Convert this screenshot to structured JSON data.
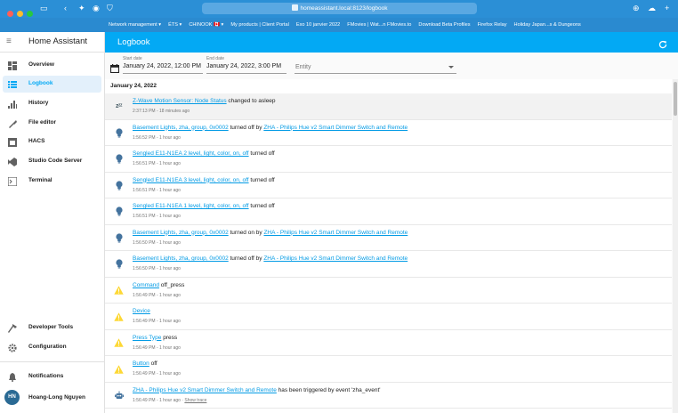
{
  "browser": {
    "url": "homeassistant.local:8123/logbook",
    "bookmarks": [
      "Network management ▾",
      "ÉTS ▾",
      "CHINOOK 🇨🇦 ▾",
      "My products | Client Portal",
      "Exo 10 janvier 2022",
      "FMovies | Wat...n FMovies.to",
      "Download Beta Profiles",
      "Firefox Relay",
      "Holiday Japan...s & Dungeons"
    ]
  },
  "sidebar": {
    "app_title": "Home Assistant",
    "items": [
      {
        "label": "Overview",
        "icon": "dashboard-icon"
      },
      {
        "label": "Logbook",
        "icon": "logbook-icon"
      },
      {
        "label": "History",
        "icon": "history-icon"
      },
      {
        "label": "File editor",
        "icon": "wrench-icon"
      },
      {
        "label": "HACS",
        "icon": "hacs-icon"
      },
      {
        "label": "Studio Code Server",
        "icon": "vscode-icon"
      },
      {
        "label": "Terminal",
        "icon": "terminal-icon"
      }
    ],
    "bottom_items": [
      {
        "label": "Developer Tools",
        "icon": "hammer-icon"
      },
      {
        "label": "Configuration",
        "icon": "gear-icon"
      },
      {
        "label": "Notifications",
        "icon": "bell-icon"
      }
    ],
    "user": {
      "initials": "HN",
      "name": "Hoang-Long Nguyen"
    },
    "accent": "#03a9f4"
  },
  "header": {
    "title": "Logbook"
  },
  "filters": {
    "start_label": "Start date",
    "start_value": "January 24, 2022, 12:00 PM",
    "end_label": "End date",
    "end_value": "January 24, 2022, 3:00 PM",
    "entity_placeholder": "Entity"
  },
  "logbook": {
    "date": "January 24, 2022",
    "entries": [
      {
        "icon": "sleep-icon",
        "link": "Z-Wave Motion Sensor: Node Status",
        "text": " changed to asleep",
        "link2": "",
        "time": "2:37:13 PM - 18 minutes ago"
      },
      {
        "icon": "bulb-icon",
        "link": "Basement Lights, zha, group, 0x0002",
        "text": " turned off by ",
        "link2": "ZHA - Philips Hue v2 Smart Dimmer Switch and Remote",
        "time": "1:56:52 PM - 1 hour ago"
      },
      {
        "icon": "bulb-icon",
        "link": "Sengled E11-N1EA 2 level, light, color, on, off",
        "text": " turned off",
        "link2": "",
        "time": "1:56:51 PM - 1 hour ago"
      },
      {
        "icon": "bulb-icon",
        "link": "Sengled E11-N1EA 3 level, light, color, on, off",
        "text": " turned off",
        "link2": "",
        "time": "1:56:51 PM - 1 hour ago"
      },
      {
        "icon": "bulb-icon",
        "link": "Sengled E11-N1EA 1 level, light, color, on, off",
        "text": " turned off",
        "link2": "",
        "time": "1:56:51 PM - 1 hour ago"
      },
      {
        "icon": "bulb-icon",
        "link": "Basement Lights, zha, group, 0x0002",
        "text": " turned on by ",
        "link2": "ZHA - Philips Hue v2 Smart Dimmer Switch and Remote",
        "time": "1:56:50 PM - 1 hour ago"
      },
      {
        "icon": "bulb-icon",
        "link": "Basement Lights, zha, group, 0x0002",
        "text": " turned off by ",
        "link2": "ZHA - Philips Hue v2 Smart Dimmer Switch and Remote",
        "time": "1:56:50 PM - 1 hour ago"
      },
      {
        "icon": "warning-icon",
        "link": "Command",
        "text": " off_press",
        "link2": "",
        "time": "1:56:49 PM - 1 hour ago"
      },
      {
        "icon": "warning-icon",
        "link": "Device",
        "text": "",
        "link2": "",
        "time": "1:56:49 PM - 1 hour ago"
      },
      {
        "icon": "warning-icon",
        "link": "Press Type",
        "text": " press",
        "link2": "",
        "time": "1:56:49 PM - 1 hour ago"
      },
      {
        "icon": "warning-icon",
        "link": "Button",
        "text": " off",
        "link2": "",
        "time": "1:56:49 PM - 1 hour ago"
      },
      {
        "icon": "robot-icon",
        "link": "ZHA - Philips Hue v2 Smart Dimmer Switch and Remote",
        "text": " has been triggered by event 'zha_event'",
        "link2": "",
        "time": "1:56:49 PM - 1 hour ago · ",
        "time_link": "Show trace"
      }
    ]
  }
}
